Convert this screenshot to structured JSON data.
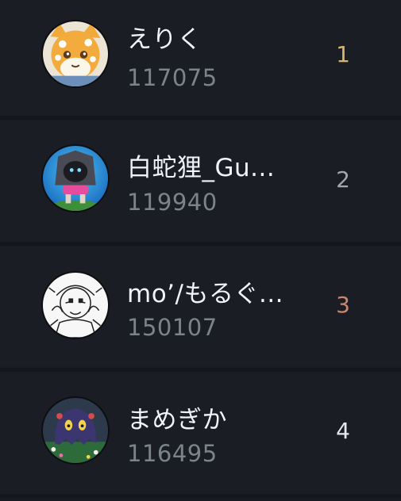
{
  "leaderboard": {
    "entries": [
      {
        "name": "えりく",
        "score": "117075",
        "rank": "1",
        "rank_color": "#d9b56c",
        "avatar_icon": "fox-character-avatar"
      },
      {
        "name": "白蛇狸_Gu...",
        "score": "119940",
        "rank": "2",
        "rank_color": "#a3a8ae",
        "avatar_icon": "wolf-character-avatar"
      },
      {
        "name": "mo’/もるぐ...",
        "score": "150107",
        "rank": "3",
        "rank_color": "#c98670",
        "avatar_icon": "lineart-character-avatar"
      },
      {
        "name": "まめぎか",
        "score": "116495",
        "rank": "4",
        "rank_color": "#e6e8eb",
        "avatar_icon": "ghost-character-avatar"
      }
    ]
  }
}
